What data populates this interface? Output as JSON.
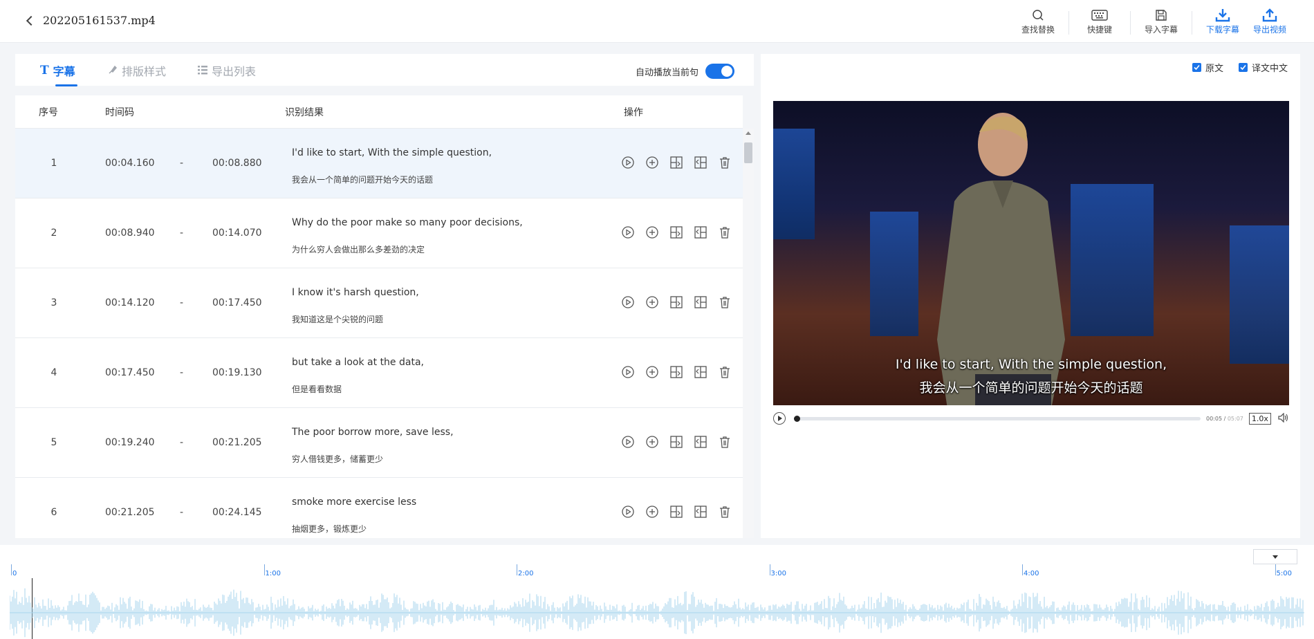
{
  "file": {
    "name": "202205161537.mp4"
  },
  "toolbar": {
    "find_replace": "查找替换",
    "shortcuts": "快捷键",
    "import_subtitle": "导入字幕",
    "download_subtitle": "下载字幕",
    "export_video": "导出视频"
  },
  "tabs": {
    "subtitles": "字幕",
    "style": "排版样式",
    "export_list": "导出列表"
  },
  "autoplay": {
    "label": "自动播放当前句",
    "enabled": true
  },
  "table": {
    "headers": {
      "index": "序号",
      "timecode": "时间码",
      "result": "识别结果",
      "actions": "操作"
    },
    "rows": [
      {
        "index": "1",
        "start": "00:04.160",
        "sep": "-",
        "end": "00:08.880",
        "en": "I'd like to start, With the simple question,",
        "zh": "我会从一个简单的问题开始今天的话题"
      },
      {
        "index": "2",
        "start": "00:08.940",
        "sep": "-",
        "end": "00:14.070",
        "en": "Why do the poor make so many poor decisions,",
        "zh": "为什么穷人会做出那么多差劲的决定"
      },
      {
        "index": "3",
        "start": "00:14.120",
        "sep": "-",
        "end": "00:17.450",
        "en": "I know it's harsh question,",
        "zh": "我知道这是个尖锐的问题"
      },
      {
        "index": "4",
        "start": "00:17.450",
        "sep": "-",
        "end": "00:19.130",
        "en": "but take a look at the data,",
        "zh": "但是看看数据"
      },
      {
        "index": "5",
        "start": "00:19.240",
        "sep": "-",
        "end": "00:21.205",
        "en": "The poor borrow more, save less,",
        "zh": "穷人借钱更多，储蓄更少"
      },
      {
        "index": "6",
        "start": "00:21.205",
        "sep": "-",
        "end": "00:24.145",
        "en": "smoke more exercise less",
        "zh": "抽烟更多，锻炼更少"
      }
    ]
  },
  "preview": {
    "show_original": "原文",
    "show_translation": "译文中文",
    "subtitle_en": "I'd like to start, With the simple question,",
    "subtitle_zh": "我会从一个简单的问题开始今天的话题",
    "current_time": "00:05",
    "time_sep": " / ",
    "duration": "05:07",
    "speed": "1.0x"
  },
  "timeline": {
    "ticks": [
      "0",
      "1:00",
      "2:00",
      "3:00",
      "4:00",
      "5:00"
    ]
  },
  "colors": {
    "accent": "#1a73e8",
    "selected_row": "#eff5fc",
    "waveform": "#a9d6ee"
  }
}
